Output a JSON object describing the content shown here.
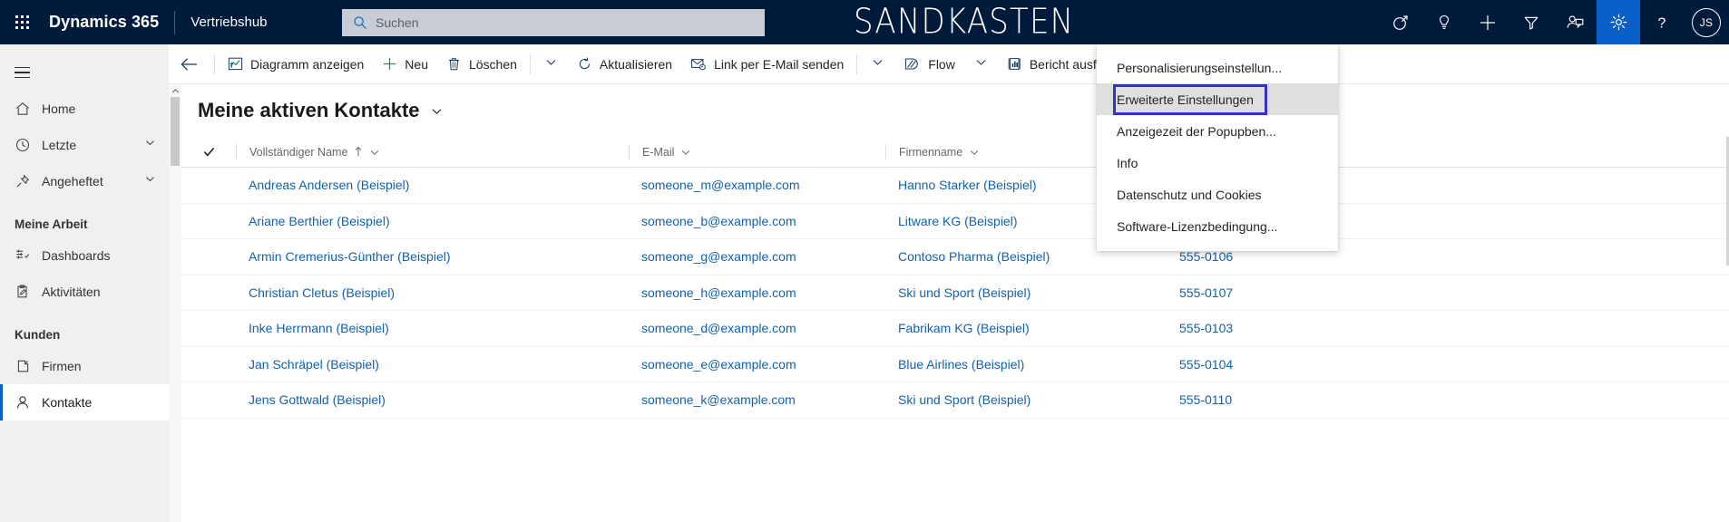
{
  "topnav": {
    "waffle_label": "app-launcher",
    "brand": "Dynamics 365",
    "app_name": "Vertriebshub",
    "environment": "SANDKASTEN",
    "search": {
      "placeholder": "Suchen",
      "value": ""
    },
    "actions": [
      {
        "name": "relationship-assistant-icon",
        "title": "Vertriebsassistent"
      },
      {
        "name": "lightbulb-icon",
        "title": "Ideen"
      },
      {
        "name": "plus-icon",
        "title": "Neu"
      },
      {
        "name": "filter-icon",
        "title": "Filter"
      },
      {
        "name": "assistant-icon",
        "title": "Assistent"
      },
      {
        "name": "gear-icon",
        "title": "Einstellungen"
      },
      {
        "name": "help-icon",
        "title": "Hilfe"
      }
    ],
    "avatar_initials": "JS"
  },
  "settings_menu": {
    "items": [
      {
        "label": "Personalisierungseinstellun...",
        "focused": false
      },
      {
        "label": "Erweiterte Einstellungen",
        "focused": true
      },
      {
        "label": "Anzeigezeit der Popupben...",
        "focused": false
      },
      {
        "label": "Info",
        "focused": false
      },
      {
        "label": "Datenschutz und Cookies",
        "focused": false
      },
      {
        "label": "Software-Lizenzbedingung...",
        "focused": false
      }
    ],
    "focus_outline_color": "#3333cc"
  },
  "sidebar": {
    "hamburger_label": "Websitemap",
    "primary": [
      {
        "label": "Home",
        "icon": "home-icon",
        "expandable": false,
        "selected": false
      },
      {
        "label": "Letzte",
        "icon": "clock-icon",
        "expandable": true,
        "selected": false
      },
      {
        "label": "Angeheftet",
        "icon": "pin-icon",
        "expandable": true,
        "selected": false
      }
    ],
    "groups": [
      {
        "title": "Meine Arbeit",
        "items": [
          {
            "label": "Dashboards",
            "icon": "dashboard-icon",
            "selected": false
          },
          {
            "label": "Aktivitäten",
            "icon": "clipboard-icon",
            "selected": false
          }
        ]
      },
      {
        "title": "Kunden",
        "items": [
          {
            "label": "Firmen",
            "icon": "company-icon",
            "selected": false
          },
          {
            "label": "Kontakte",
            "icon": "person-icon",
            "selected": true
          }
        ]
      }
    ]
  },
  "commandbar": {
    "back_label": "Zurück",
    "commands": [
      {
        "label": "Diagramm anzeigen",
        "icon": "chart-icon",
        "caret": false
      },
      {
        "label": "Neu",
        "icon": "plus-icon",
        "caret": false
      },
      {
        "label": "Löschen",
        "icon": "trash-icon",
        "caret": true
      },
      {
        "label": "Aktualisieren",
        "icon": "refresh-icon",
        "caret": false
      },
      {
        "label": "Link per E-Mail senden",
        "icon": "email-link-icon",
        "caret": true
      },
      {
        "label": "Flow",
        "icon": "flow-icon",
        "caret": true
      },
      {
        "label": "Bericht ausführen",
        "icon": "report-icon",
        "caret": false
      }
    ]
  },
  "view": {
    "title": "Meine aktiven Kontakte",
    "selector_label": "Ansicht wechseln"
  },
  "grid": {
    "select_all_label": "Alle auswählen",
    "columns": [
      {
        "label": "Vollständiger Name",
        "sorted": "asc",
        "key": "name"
      },
      {
        "label": "E-Mail",
        "sorted": "",
        "key": "email"
      },
      {
        "label": "Firmenname",
        "sorted": "",
        "key": "company"
      },
      {
        "label": "",
        "sorted": "",
        "key": "phone"
      }
    ],
    "rows": [
      {
        "name": "Andreas Andersen (Beispiel)",
        "email": "someone_m@example.com",
        "company": "Hanno Starker (Beispiel)",
        "phone": ""
      },
      {
        "name": "Ariane Berthier (Beispiel)",
        "email": "someone_b@example.com",
        "company": "Litware KG (Beispiel)",
        "phone": ""
      },
      {
        "name": "Armin Cremerius-Günther (Beispiel)",
        "email": "someone_g@example.com",
        "company": "Contoso Pharma (Beispiel)",
        "phone": "555-0106"
      },
      {
        "name": "Christian Cletus (Beispiel)",
        "email": "someone_h@example.com",
        "company": "Ski und Sport (Beispiel)",
        "phone": "555-0107"
      },
      {
        "name": "Inke Herrmann (Beispiel)",
        "email": "someone_d@example.com",
        "company": "Fabrikam KG (Beispiel)",
        "phone": "555-0103"
      },
      {
        "name": "Jan Schräpel (Beispiel)",
        "email": "someone_e@example.com",
        "company": "Blue Airlines (Beispiel)",
        "phone": "555-0104"
      },
      {
        "name": "Jens Gottwald (Beispiel)",
        "email": "someone_k@example.com",
        "company": "Ski und Sport (Beispiel)",
        "phone": "555-0110"
      }
    ]
  },
  "colors": {
    "nav_background": "#001a3c",
    "accent_blue": "#0b5fc9",
    "link_blue": "#1262ab",
    "sidebar_background": "#f0f0f0",
    "focus_outline": "#3333cc"
  }
}
